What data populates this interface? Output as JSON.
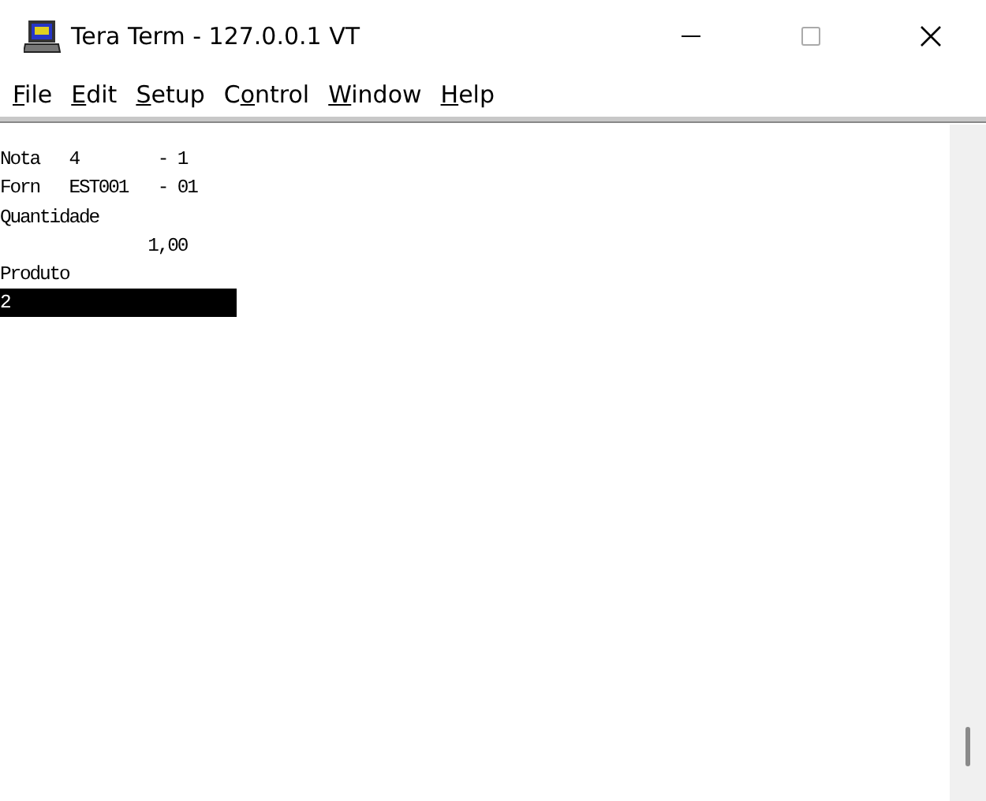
{
  "window": {
    "title": "Tera Term - 127.0.0.1 VT"
  },
  "menu": [
    {
      "parts": [
        {
          "text": "F",
          "underlined": true
        },
        {
          "text": "ile",
          "underlined": false
        }
      ]
    },
    {
      "parts": [
        {
          "text": "E",
          "underlined": true
        },
        {
          "text": "dit",
          "underlined": false
        }
      ]
    },
    {
      "parts": [
        {
          "text": "S",
          "underlined": true
        },
        {
          "text": "etup",
          "underlined": false
        }
      ]
    },
    {
      "parts": [
        {
          "text": "C",
          "underlined": false
        },
        {
          "text": "o",
          "underlined": true
        },
        {
          "text": "ntrol",
          "underlined": false
        }
      ]
    },
    {
      "parts": [
        {
          "text": "W",
          "underlined": true
        },
        {
          "text": "indow",
          "underlined": false
        }
      ]
    },
    {
      "parts": [
        {
          "text": "H",
          "underlined": true
        },
        {
          "text": "elp",
          "underlined": false
        }
      ]
    }
  ],
  "terminal": {
    "lines": [
      "Nota   4        - 1",
      "Forn   EST001   - 01",
      "Quantidade",
      "               1,00",
      "Produto"
    ],
    "input": {
      "value": "2"
    }
  }
}
